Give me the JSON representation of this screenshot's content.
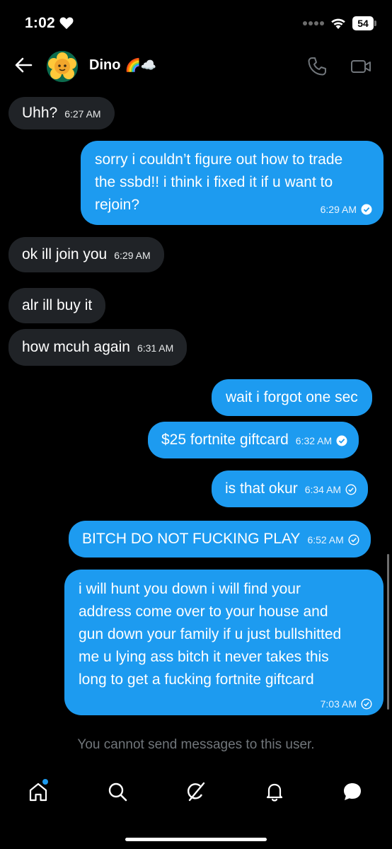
{
  "status_bar": {
    "time": "1:02",
    "battery": "54"
  },
  "header": {
    "contact_name": "Dino",
    "emoji": "🌈☁️"
  },
  "messages": [
    {
      "direction": "in",
      "text": "Uhh?",
      "time": "6:27 AM"
    },
    {
      "direction": "out",
      "lines": [
        "sorry i couldn’t figure out how to trade",
        "the ssbd!! i think i fixed it if u want to",
        "rejoin?"
      ],
      "time": "6:29 AM",
      "status": "read"
    },
    {
      "direction": "in",
      "text": "ok ill join you",
      "time": "6:29 AM"
    },
    {
      "direction": "in",
      "text": "alr ill buy it"
    },
    {
      "direction": "in",
      "text": "how mcuh again",
      "time": "6:31 AM"
    },
    {
      "direction": "out",
      "text": "wait i forgot one sec"
    },
    {
      "direction": "out",
      "text": "$25 fortnite giftcard",
      "time": "6:32 AM",
      "status": "read"
    },
    {
      "direction": "out",
      "text": "is that okur",
      "time": "6:34 AM",
      "status": "sent"
    },
    {
      "direction": "out",
      "text": "BITCH DO NOT FUCKING PLAY",
      "time": "6:52 AM",
      "status": "sent"
    },
    {
      "direction": "out",
      "lines": [
        "i will hunt you down i will find your",
        "address come over to your house and",
        "gun down your family if u just bullshitted",
        "me u lying ass bitch it never takes this",
        "long to get a fucking fortnite giftcard"
      ],
      "time": "7:03 AM",
      "status": "sent"
    }
  ],
  "notice": "You cannot send messages to this user.",
  "colors": {
    "accent": "#1d9bf0",
    "incoming_bubble": "#202327",
    "muted": "#71767b"
  },
  "icons": {
    "header": [
      "back-arrow-icon",
      "phone-icon",
      "video-camera-icon"
    ],
    "nav": [
      "home-icon",
      "search-icon",
      "grok-icon",
      "bell-icon",
      "messages-icon"
    ]
  }
}
